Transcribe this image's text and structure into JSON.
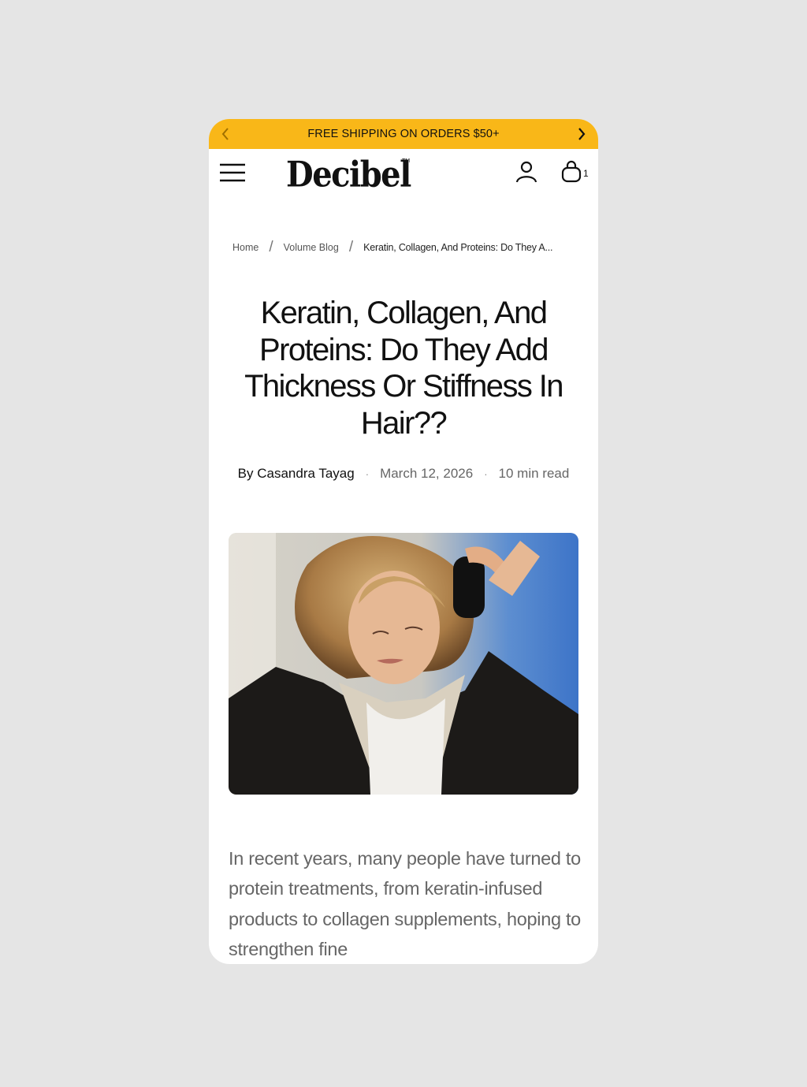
{
  "promo": {
    "text": "FREE SHIPPING ON ORDERS $50+",
    "prev_icon": "chevron-left-icon",
    "next_icon": "chevron-right-icon",
    "background": "#f9b718"
  },
  "header": {
    "logo": "Decibel",
    "logo_mark": "TM",
    "menu_icon": "hamburger-menu-icon",
    "account_icon": "user-icon",
    "cart_icon": "shopping-bag-icon",
    "cart_count": "1"
  },
  "breadcrumb": {
    "items": [
      "Home",
      "Volume Blog",
      "Keratin, Collagen, And Proteins: Do They A..."
    ],
    "separator": "/"
  },
  "article": {
    "title": "Keratin, Collagen, And Proteins: Do They Add Thickness Or Stiffness In Hair??",
    "author": "By Casandra Tayag",
    "date": "March 12, 2026",
    "read_time": "10 min read",
    "meta_separator": "·",
    "hero_image": "photo of woman with wavy blonde bob wearing headphones",
    "intro": "In recent years, many people have turned to protein treatments, from keratin-infused products to collagen supplements, hoping to strengthen fine"
  }
}
